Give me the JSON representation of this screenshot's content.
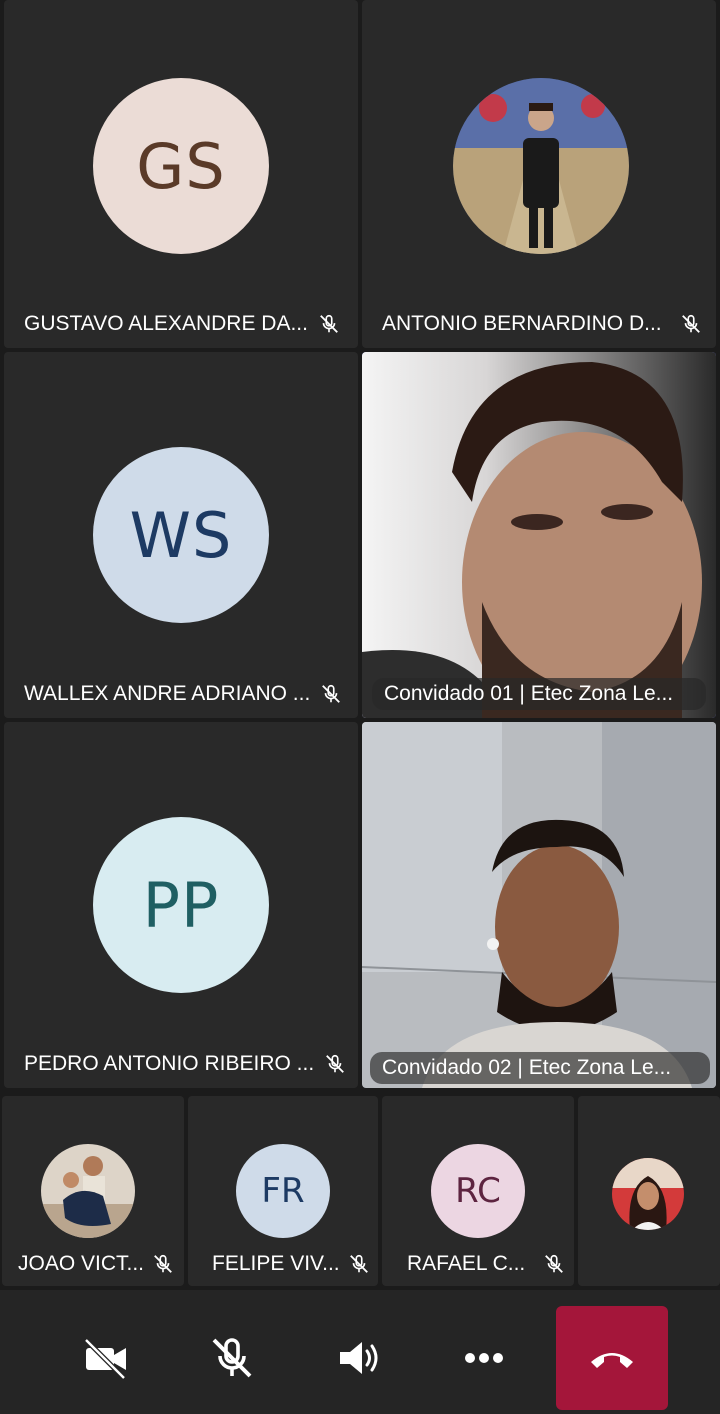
{
  "participants": {
    "gustavo": {
      "initials": "GS",
      "name": "GUSTAVO ALEXANDRE DA...",
      "avatar_bg": "#ebdcd6",
      "avatar_fg": "#5a3a28"
    },
    "antonio": {
      "name": "ANTONIO BERNARDINO D..."
    },
    "wallex": {
      "initials": "WS",
      "name": "WALLEX ANDRE ADRIANO ...",
      "avatar_bg": "#cfdbe9",
      "avatar_fg": "#1d3a63"
    },
    "convidado01": {
      "name": "Convidado 01 | Etec Zona Le..."
    },
    "pedro": {
      "initials": "PP",
      "name": "PEDRO ANTONIO RIBEIRO ...",
      "avatar_bg": "#d8ecf1",
      "avatar_fg": "#1f5f63"
    },
    "convidado02": {
      "name": "Convidado 02 | Etec Zona Le..."
    },
    "joao": {
      "name": "JOAO VICT..."
    },
    "felipe": {
      "initials": "FR",
      "name": "FELIPE VIV...",
      "avatar_bg": "#cfdbe9",
      "avatar_fg": "#1d3a63"
    },
    "rafael": {
      "initials": "RC",
      "name": "RAFAEL C...",
      "avatar_bg": "#ecd6e2",
      "avatar_fg": "#5d2440"
    }
  },
  "toolbar": {
    "camera": "camera-off-icon",
    "mic": "mic-off-icon",
    "speaker": "speaker-icon",
    "more": "more-options-icon",
    "hangup": "hang-up-icon",
    "hangup_color": "#a4163a"
  },
  "colors": {
    "background": "#1b1b1b",
    "tile": "#292929",
    "active_border": "#7f85f5"
  }
}
